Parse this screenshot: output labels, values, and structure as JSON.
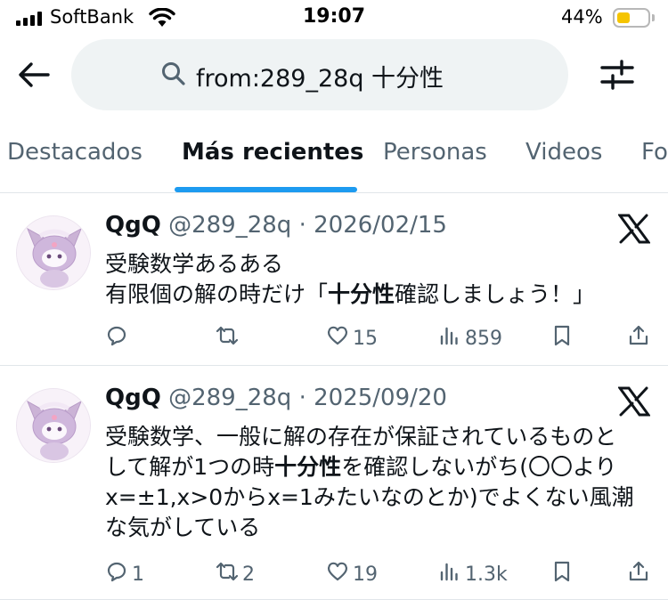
{
  "status_bar": {
    "carrier": "SoftBank",
    "time": "19:07",
    "battery": "44%",
    "battery_level": 0.44,
    "battery_color": "#f5c400"
  },
  "search": {
    "query": "from:289_28q 十分性"
  },
  "tabs": [
    {
      "label": "Destacados",
      "active": false
    },
    {
      "label": "Más recientes",
      "active": true
    },
    {
      "label": "Personas",
      "active": false
    },
    {
      "label": "Videos",
      "active": false
    },
    {
      "label": "Fo",
      "active": false
    }
  ],
  "accent_color": "#1d9bf0",
  "tweets": [
    {
      "name": "QgQ",
      "handle": "@289_28q",
      "sep": "·",
      "date": "2026/02/15",
      "lines": [
        [
          {
            "t": "受験数学あるある",
            "b": false
          }
        ],
        [
          {
            "t": "有限個の解の時だけ「",
            "b": false
          },
          {
            "t": "十分性",
            "b": true
          },
          {
            "t": "確認しましょう！」",
            "b": false
          }
        ]
      ],
      "replies": "",
      "retweets": "",
      "likes": "15",
      "views": "859"
    },
    {
      "name": "QgQ",
      "handle": "@289_28q",
      "sep": "·",
      "date": "2025/09/20",
      "lines": [
        [
          {
            "t": "受験数学、一般に解の存在が保証されているものと",
            "b": false
          }
        ],
        [
          {
            "t": "して解が1つの時",
            "b": false
          },
          {
            "t": "十分性",
            "b": true
          },
          {
            "t": "を確認しないがち(〇〇より",
            "b": false
          }
        ],
        [
          {
            "t": "x=±1,x>0からx=1みたいなのとか)でよくない風潮",
            "b": false
          }
        ],
        [
          {
            "t": "な気がしている",
            "b": false
          }
        ]
      ],
      "replies": "1",
      "retweets": "2",
      "likes": "19",
      "views": "1.3k"
    }
  ],
  "icons": [
    "back-arrow-icon",
    "search-icon",
    "filter-icon",
    "x-logo-icon",
    "reply-icon",
    "retweet-icon",
    "like-icon",
    "views-icon",
    "bookmark-icon",
    "share-icon"
  ]
}
